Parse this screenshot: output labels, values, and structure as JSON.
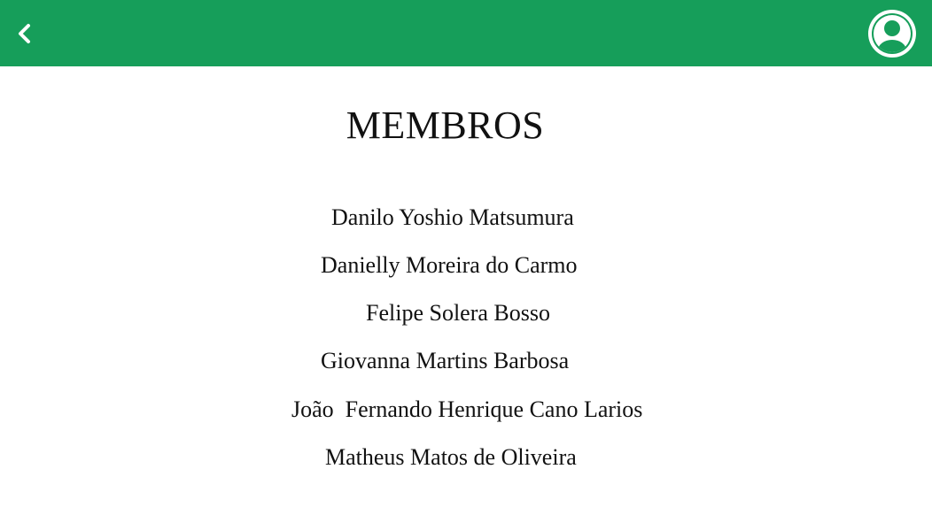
{
  "header": {
    "back_icon": "chevron-left-icon",
    "profile_icon": "user-circle-icon",
    "accent_color": "#169e5a"
  },
  "page": {
    "title": "MEMBROS"
  },
  "members": [
    "Danilo Yoshio Matsumura",
    "Danielly Moreira do Carmo",
    "Felipe Solera Bosso",
    "Giovanna Martins Barbosa",
    "João  Fernando Henrique Cano Larios",
    "Matheus Matos de Oliveira"
  ]
}
